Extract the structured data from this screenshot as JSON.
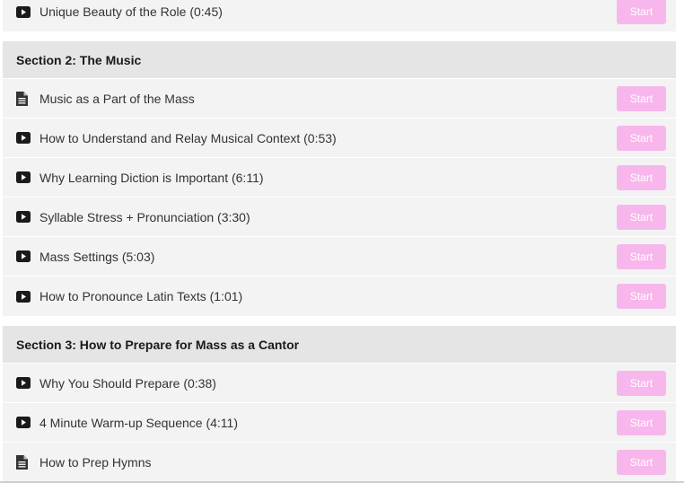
{
  "sections": [
    {
      "title": "",
      "lectures": [
        {
          "icon": "video-play-icon",
          "title": "Unique Beauty of the Role (0:45)",
          "action": "Start"
        }
      ]
    },
    {
      "title": "Section 2: The Music",
      "lectures": [
        {
          "icon": "document-icon",
          "title": "Music as a Part of the Mass",
          "action": "Start"
        },
        {
          "icon": "video-play-icon",
          "title": "How to Understand and Relay Musical Context (0:53)",
          "action": "Start"
        },
        {
          "icon": "video-play-icon",
          "title": "Why Learning Diction is Important (6:11)",
          "action": "Start"
        },
        {
          "icon": "video-play-icon",
          "title": "Syllable Stress + Pronunciation (3:30)",
          "action": "Start"
        },
        {
          "icon": "video-play-icon",
          "title": "Mass Settings (5:03)",
          "action": "Start"
        },
        {
          "icon": "video-play-icon",
          "title": "How to Pronounce Latin Texts (1:01)",
          "action": "Start"
        }
      ]
    },
    {
      "title": "Section 3: How to Prepare for Mass as a Cantor",
      "lectures": [
        {
          "icon": "video-play-icon",
          "title": "Why You Should Prepare (0:38)",
          "action": "Start"
        },
        {
          "icon": "video-play-icon",
          "title": "4 Minute Warm-up Sequence (4:11)",
          "action": "Start"
        },
        {
          "icon": "document-icon",
          "title": "How to Prep Hymns",
          "action": "Start"
        }
      ]
    }
  ],
  "colors": {
    "start_button": "#f8b7ec",
    "section_header_bg": "#e5e5e5",
    "row_bg": "#f3f3f3"
  }
}
